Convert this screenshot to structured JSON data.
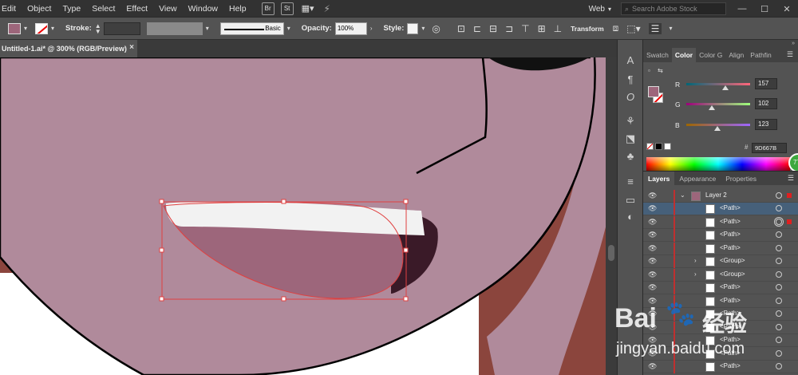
{
  "menubar": {
    "items": [
      "Edit",
      "Object",
      "Type",
      "Select",
      "Effect",
      "View",
      "Window",
      "Help"
    ],
    "bridge_label": "Br",
    "stock_label": "St",
    "workspace": "Web",
    "search_placeholder": "Search Adobe Stock",
    "window_controls": [
      "—",
      "☐",
      "✕"
    ]
  },
  "controlbar": {
    "fill_color": "#9D667B",
    "stroke_label": "Stroke:",
    "brush_label": "Basic",
    "opacity_label": "Opacity:",
    "opacity_value": "100%",
    "style_label": "Style:",
    "transform_label": "Transform"
  },
  "document": {
    "tab_title": "Untitled-1.ai* @ 300% (RGB/Preview)",
    "close_glyph": "×"
  },
  "color_panel": {
    "tabs": [
      "Swatch",
      "Color",
      "Color G",
      "Align",
      "Pathfin"
    ],
    "active_tab": "Color",
    "channels": [
      {
        "label": "R",
        "value": "157",
        "fraction": 0.616
      },
      {
        "label": "G",
        "value": "102",
        "fraction": 0.4
      },
      {
        "label": "B",
        "value": "123",
        "fraction": 0.482
      }
    ],
    "hex_value": "9D667B",
    "hash_label": "#",
    "badge_text": "77"
  },
  "layers_panel": {
    "tabs": [
      "Layers",
      "Appearance",
      "Properties"
    ],
    "active_tab": "Layers",
    "layer_name": "Layer 2",
    "rows": [
      {
        "name": "<Path>",
        "selected": true
      },
      {
        "name": "<Path>",
        "selected": false
      },
      {
        "name": "<Path>",
        "selected": false
      },
      {
        "name": "<Path>",
        "selected": false
      },
      {
        "name": "<Group>",
        "selected": false
      },
      {
        "name": "<Group>",
        "selected": false
      },
      {
        "name": "<Path>",
        "selected": false
      },
      {
        "name": "<Path>",
        "selected": false
      },
      {
        "name": "<Path>",
        "selected": false
      },
      {
        "name": "<Path>",
        "selected": false
      },
      {
        "name": "<Path>",
        "selected": false
      },
      {
        "name": "<Path>",
        "selected": false
      },
      {
        "name": "<Path>",
        "selected": false
      }
    ]
  },
  "watermark": {
    "brand": "Bai",
    "brand2": "经验",
    "url": "jingyan.baidu.com"
  },
  "colors": {
    "skin": "#B08A9B",
    "mouth": "#9D667B",
    "shadow": "#3A1A28",
    "hair": "#8B453D",
    "teeth": "#F2F2F2",
    "selection": "#E04040"
  }
}
